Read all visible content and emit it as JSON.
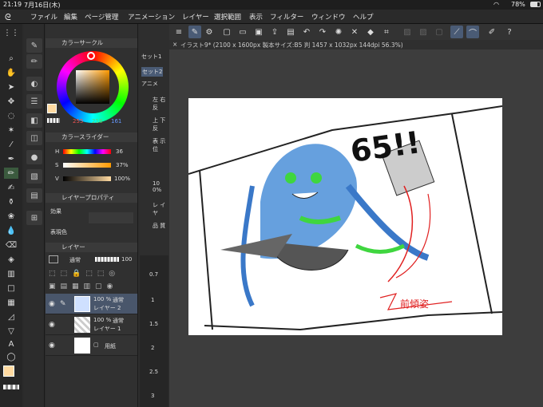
{
  "status": {
    "time": "21:19",
    "date": "7月16日(木)",
    "battery": "78%"
  },
  "menu": [
    "ファイル",
    "編集",
    "ページ管理",
    "アニメーション",
    "レイヤー",
    "選択範囲",
    "表示",
    "フィルター",
    "ウィンドウ",
    "ヘルプ"
  ],
  "tab": {
    "title": "イラスト9* (2100 x 1600px 製本サイズ:B5 判 1457 x 1032px 144dpi 56.3%)"
  },
  "colorwheel": {
    "title": "カラーサークル",
    "r": "255",
    "g": "218",
    "b": "161"
  },
  "colorslider": {
    "title": "カラースライダー",
    "h": "36",
    "s": "37%",
    "v": "100%",
    "h_label": "H",
    "s_label": "S",
    "v_label": "V"
  },
  "layerprop": {
    "title": "レイヤープロパティ",
    "effect": "効果",
    "expr": "表現色"
  },
  "layerpanel": {
    "title": "レイヤー",
    "blend": "通常",
    "opacity": "100",
    "layers": [
      {
        "pct": "100 %",
        "mode": "通常",
        "name": "レイヤー 2"
      },
      {
        "pct": "100 %",
        "mode": "通常",
        "name": "レイヤー 1"
      },
      {
        "pct": "",
        "mode": "",
        "name": "用紙"
      }
    ]
  },
  "rightcol": {
    "set1": "セット1",
    "set2": "セット2",
    "anim": "アニメ",
    "items": [
      "左 右反",
      "上 下反",
      "表 示位",
      "10 0%",
      "レ イヤ",
      "品 質"
    ]
  },
  "ruler": [
    "0.7",
    "1",
    "1.5",
    "2",
    "2.5",
    "3"
  ],
  "drawing": {
    "text": "65!!",
    "note": "前傾姿"
  },
  "colors": {
    "accent": "#4a5b75",
    "main_color": "#ffdaa1"
  }
}
